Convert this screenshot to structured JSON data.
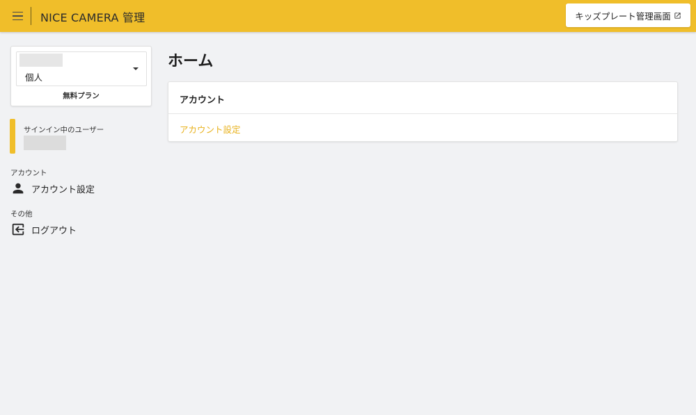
{
  "header": {
    "title": "NICE CAMERA 管理",
    "kids_plate_button": "キッズプレート管理画面"
  },
  "sidebar": {
    "account_select": {
      "value": "個人",
      "plan": "無料プラン"
    },
    "signed_in_user_label": "サインイン中のユーザー",
    "sections": [
      {
        "label": "アカウント",
        "items": [
          {
            "label": "アカウント設定",
            "icon": "person-icon"
          }
        ]
      },
      {
        "label": "その他",
        "items": [
          {
            "label": "ログアウト",
            "icon": "logout-icon"
          }
        ]
      }
    ]
  },
  "main": {
    "page_title": "ホーム",
    "panel": {
      "title": "アカウント",
      "link": "アカウント設定"
    }
  },
  "colors": {
    "accent": "#f0be2a",
    "link": "#e8b21e",
    "background": "#f1f2f4"
  }
}
